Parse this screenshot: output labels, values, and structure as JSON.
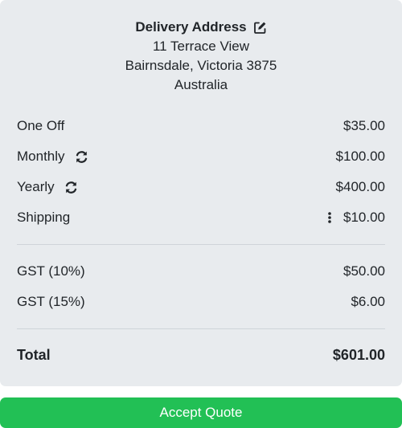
{
  "address": {
    "title": "Delivery Address",
    "edit_icon": "edit-icon",
    "line1": "11 Terrace View",
    "line2": "Bairnsdale, Victoria 3875",
    "line3": "Australia"
  },
  "items": [
    {
      "label": "One Off",
      "amount": "$35.00"
    },
    {
      "label": "Monthly",
      "amount": "$100.00",
      "icon": "sync-icon"
    },
    {
      "label": "Yearly",
      "amount": "$400.00",
      "icon": "sync-icon"
    },
    {
      "label": "Shipping",
      "amount": "$10.00",
      "menu_icon": "vertical-dots-icon"
    }
  ],
  "taxes": [
    {
      "label": "GST (10%)",
      "amount": "$50.00"
    },
    {
      "label": "GST (15%)",
      "amount": "$6.00"
    }
  ],
  "total": {
    "label": "Total",
    "amount": "$601.00"
  },
  "actions": {
    "accept_label": "Accept Quote"
  },
  "colors": {
    "card_bg": "#e8ebee",
    "accept_bg": "#22c055",
    "text": "#212529"
  }
}
